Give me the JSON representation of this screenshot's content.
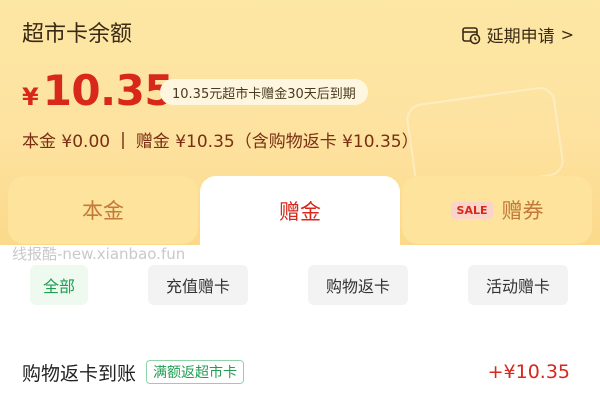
{
  "header": {
    "title": "超市卡余额",
    "extend_label": "延期申请",
    "extend_chevron": ">",
    "currency": "¥",
    "balance": "10.35",
    "expire_notice": "10.35元超市卡赠金30天后到期",
    "principal": "本金 ¥0.00",
    "separator": "|",
    "bonus": "赠金 ¥10.35（含购物返卡 ¥10.35）"
  },
  "tabs": [
    {
      "label": "本金"
    },
    {
      "label": "赠金",
      "active": true
    },
    {
      "label": "赠券",
      "badge": "SALE"
    }
  ],
  "watermark": "线报酷-new.xianbao.fun",
  "filters": [
    {
      "label": "全部",
      "active": true
    },
    {
      "label": "充值赠卡"
    },
    {
      "label": "购物返卡"
    },
    {
      "label": "活动赠卡"
    }
  ],
  "records": [
    {
      "title": "购物返卡到账",
      "tag": "满额返超市卡",
      "amount": "+¥10.35"
    }
  ],
  "colors": {
    "accent_red": "#d8271b",
    "header_bg": "#fde2a0",
    "active_green": "#1f9e52"
  },
  "icons": {
    "extend_icon": "calendar-clock-icon",
    "chevron": "chevron-right-icon"
  }
}
